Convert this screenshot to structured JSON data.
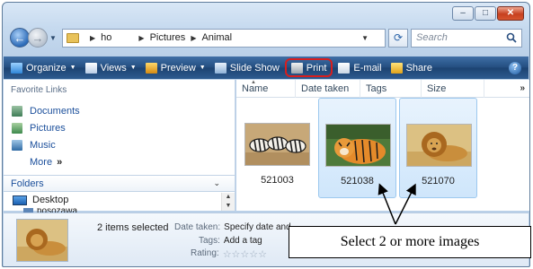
{
  "address": {
    "crumbs": [
      "ho",
      "Pictures",
      "Animal"
    ]
  },
  "search": {
    "placeholder": "Search"
  },
  "toolbar": {
    "organize": "Organize",
    "views": "Views",
    "preview": "Preview",
    "slideshow": "Slide Show",
    "print": "Print",
    "email": "E-mail",
    "share": "Share",
    "help_glyph": "?"
  },
  "nav": {
    "favorite_links_title": "Favorite Links",
    "favorites": [
      "Documents",
      "Pictures",
      "Music"
    ],
    "more": "More",
    "folders_title": "Folders",
    "desktop": "Desktop",
    "user_folder": "hosozawa"
  },
  "columns": [
    "Name",
    "Date taken",
    "Tags",
    "Size"
  ],
  "files": [
    {
      "name": "521003",
      "selected": false,
      "image": "zebras"
    },
    {
      "name": "521038",
      "selected": true,
      "image": "tiger"
    },
    {
      "name": "521070",
      "selected": true,
      "image": "lion"
    }
  ],
  "details": {
    "selection_text": "2 items selected",
    "date_taken_label": "Date taken:",
    "date_taken_value": "Specify date and",
    "tags_label": "Tags:",
    "tags_value": "Add a tag",
    "rating_label": "Rating:",
    "rating_stars": "☆☆☆☆☆"
  },
  "callout": {
    "text": "Select 2 or more images"
  },
  "colors": {
    "toolbar": "#234d7f",
    "highlight_ring": "#d81e1e",
    "selection": "#cfe6fb",
    "link": "#1b4f9b"
  }
}
